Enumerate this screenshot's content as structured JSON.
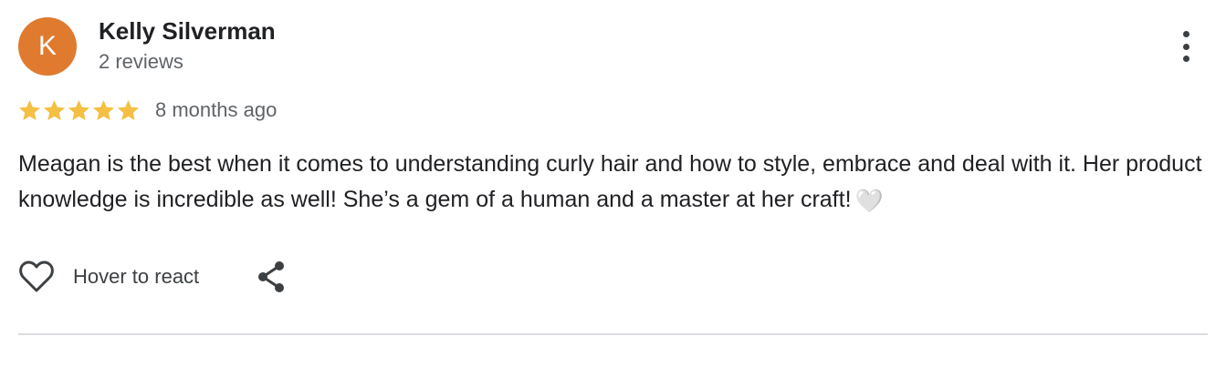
{
  "review": {
    "author": {
      "initial": "K",
      "name": "Kelly Silverman",
      "meta": "2 reviews",
      "avatar_color": "#e07a2f"
    },
    "rating": {
      "value": 5,
      "max": 5,
      "star_color": "#f4bf42",
      "star_icon": "star-icon"
    },
    "date": "8 months ago",
    "text": "Meagan is the best when it comes to understanding curly hair and how to style, embrace and deal with it. Her product knowledge is incredible as well! She’s a gem of a human and a master at her craft!",
    "text_emoji": "🤍",
    "actions": {
      "react_label": "Hover to react",
      "react_icon": "heart-outline-icon",
      "share_icon": "share-icon",
      "more_icon": "more-vertical-icon"
    }
  }
}
